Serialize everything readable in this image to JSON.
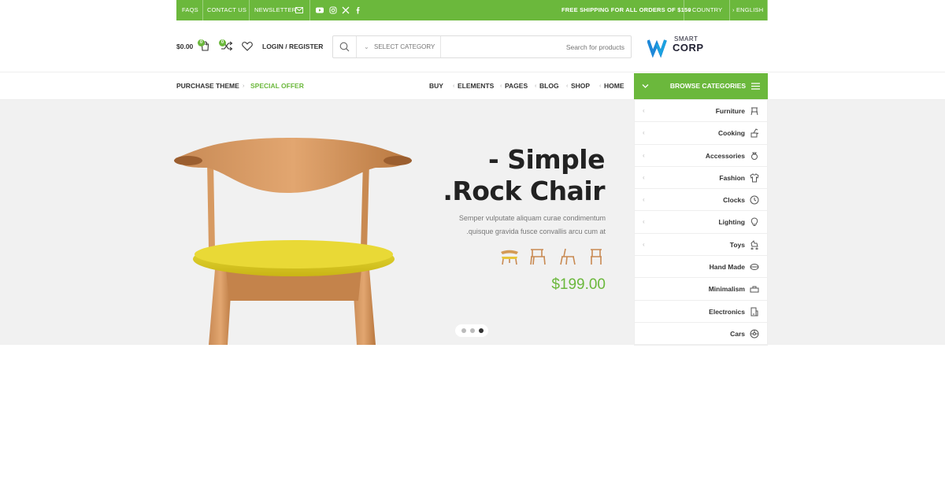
{
  "topbar": {
    "faqs": "FAQS",
    "contact": "CONTACT US",
    "newsletter": "NEWSLETTER",
    "shipping": "FREE SHIPPING FOR ALL ORDERS OF $150",
    "country": "COUNTRY",
    "language": "ENGLISH",
    "social_icons": [
      "youtube-icon",
      "instagram-icon",
      "x-icon",
      "facebook-icon"
    ],
    "color": "#6bb83c"
  },
  "header": {
    "cart_total": "$0.00",
    "cart_count": "0",
    "compare_count": "0",
    "login_label": "LOGIN / REGISTER",
    "search": {
      "category": "SELECT CATEGORY",
      "placeholder": "Search for products"
    },
    "logo": {
      "line1": "SMART",
      "line2": "CORP",
      "mark": "W"
    }
  },
  "nav": {
    "left": [
      "PURCHASE THEME",
      "SPECIAL OFFER"
    ],
    "right": [
      "BUY",
      "ELEMENTS",
      "PAGES",
      "BLOG",
      "SHOP",
      "HOME"
    ],
    "browse_label": "BROWSE CATEGORIES"
  },
  "hero": {
    "title_line1": "- Simple",
    "title_line2": ".Rock Chair",
    "desc_line1": "Semper vulputate aliquam curae condimentum",
    "desc_line2": ".quisque gravida fusce convallis arcu cum at",
    "price": "$199.00",
    "slides": 3,
    "active_slide": 3
  },
  "categories": [
    {
      "label": "Furniture",
      "icon": "chair-icon",
      "has_sub": true
    },
    {
      "label": "Cooking",
      "icon": "cooking-icon",
      "has_sub": true
    },
    {
      "label": "Accessories",
      "icon": "accessories-icon",
      "has_sub": true
    },
    {
      "label": "Fashion",
      "icon": "shirt-icon",
      "has_sub": true
    },
    {
      "label": "Clocks",
      "icon": "clock-icon",
      "has_sub": true
    },
    {
      "label": "Lighting",
      "icon": "bulb-icon",
      "has_sub": true
    },
    {
      "label": "Toys",
      "icon": "toy-icon",
      "has_sub": true
    },
    {
      "label": "Hand Made",
      "icon": "handmade-icon",
      "has_sub": false
    },
    {
      "label": "Minimalism",
      "icon": "minimalism-icon",
      "has_sub": false
    },
    {
      "label": "Electronics",
      "icon": "electronics-icon",
      "has_sub": false
    },
    {
      "label": "Cars",
      "icon": "car-icon",
      "has_sub": false
    }
  ]
}
